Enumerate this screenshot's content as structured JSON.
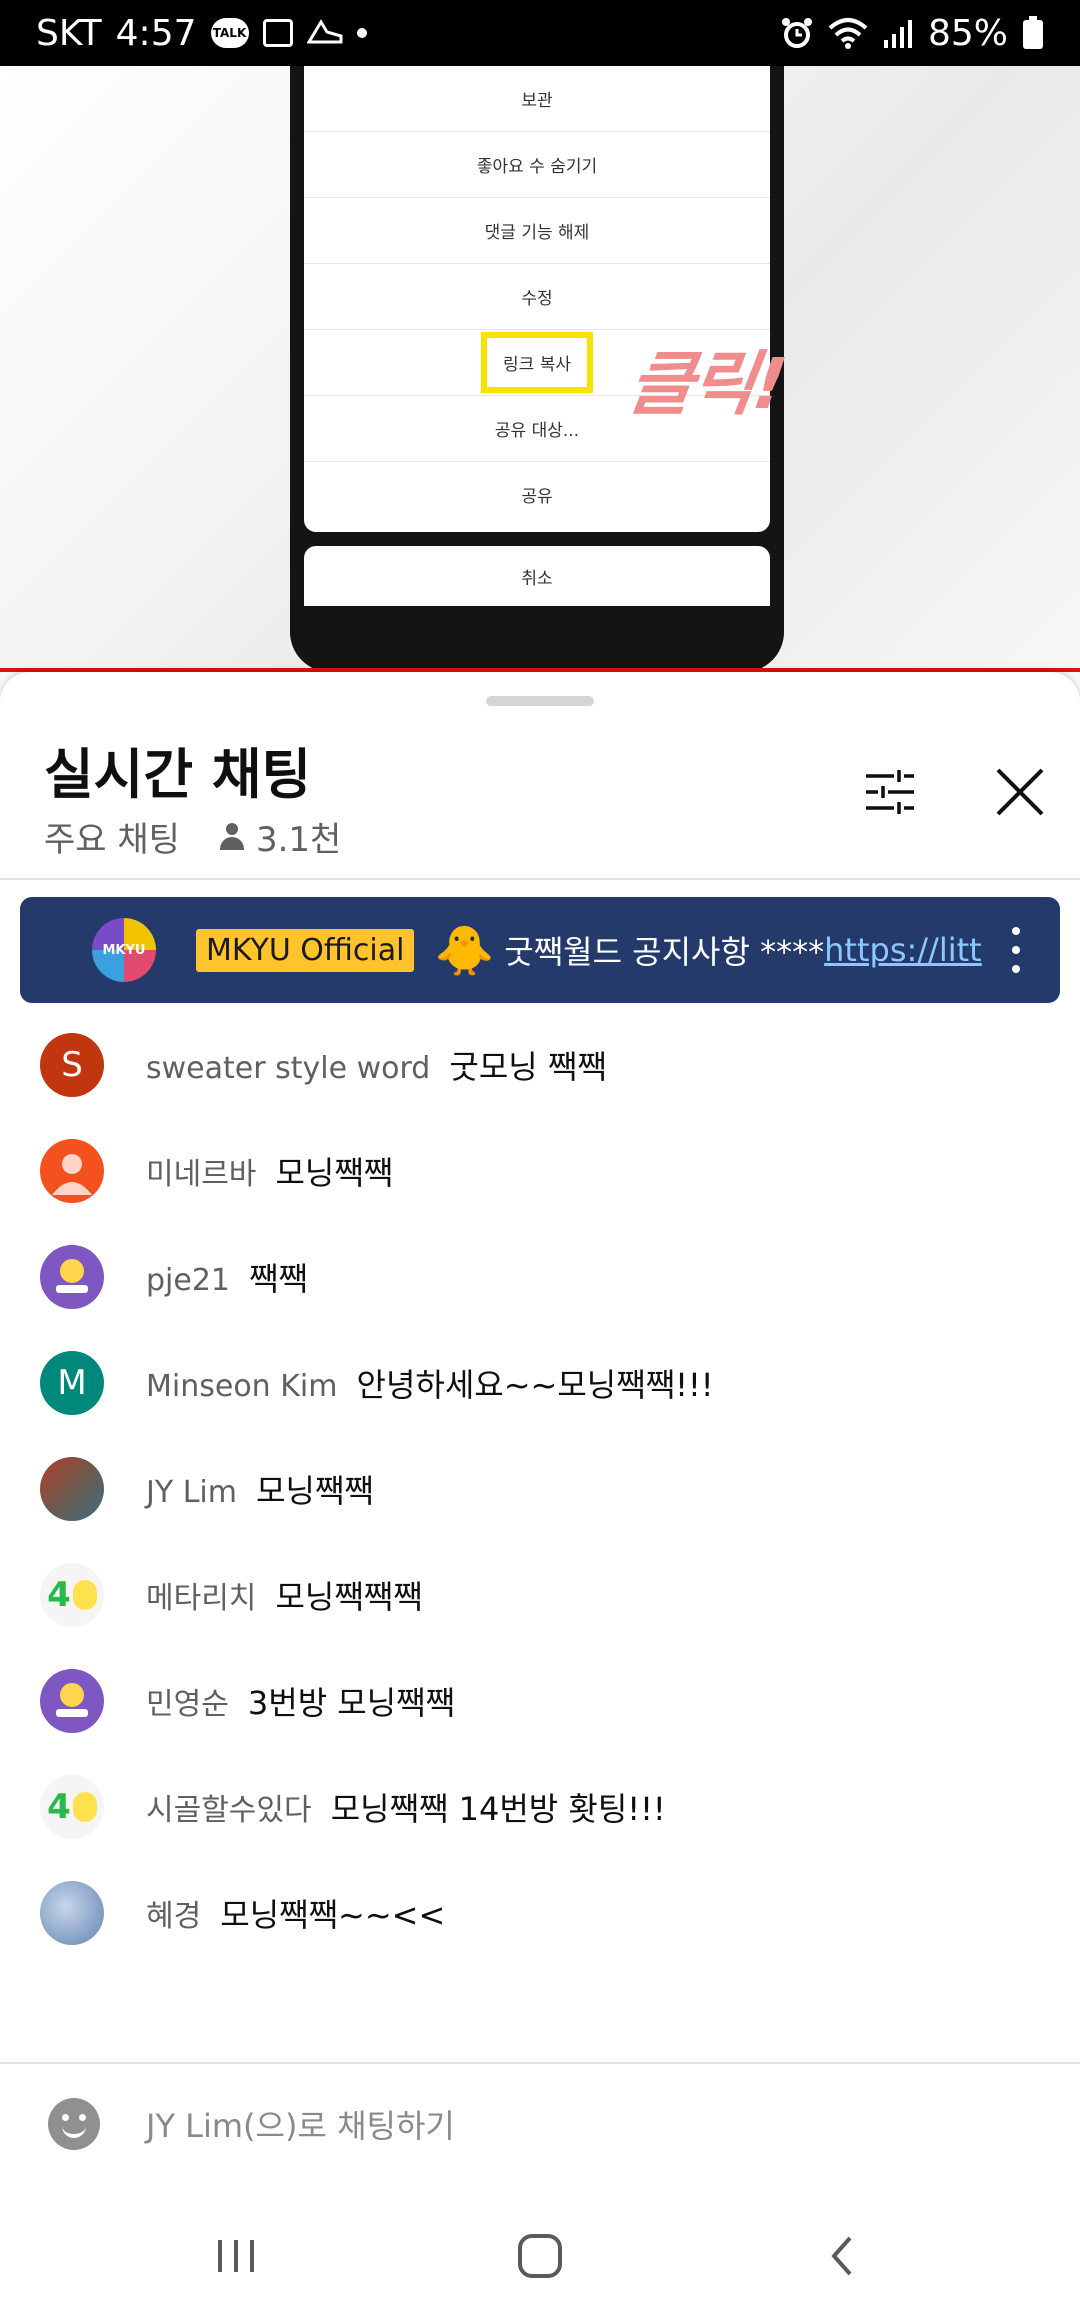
{
  "status_bar": {
    "carrier": "SKT",
    "time": "4:57",
    "talk_icon_text": "TALK",
    "battery": "85%",
    "icons": [
      "kakaotalk-icon",
      "gallery-icon",
      "sneaker-icon",
      "dot-icon",
      "alarm-icon",
      "wifi-icon",
      "signal-icon",
      "battery-icon"
    ]
  },
  "video": {
    "sheet_items": [
      "보관",
      "좋아요 수 숨기기",
      "댓글 기능 해제",
      "수정",
      "링크 복사",
      "공유 대상...",
      "공유"
    ],
    "highlighted_item_index": 4,
    "cancel": "취소",
    "overlay_text": "클릭!",
    "overlay_color": "#f08c8c",
    "highlight_color": "#f5e400"
  },
  "chat_panel": {
    "title": "실시간 채팅",
    "mode": "주요 채팅",
    "viewers": "3.1천",
    "pinned": {
      "avatar_text": "MKYU",
      "author": "MKYU Official",
      "emoji": "🐥",
      "text": "굿짹월드 공지사항 ****",
      "link": "https://litt"
    },
    "messages": [
      {
        "author": "sweater style word",
        "text": "굿모닝 짹짹",
        "avatar": "S",
        "avatar_color": "#c1360f"
      },
      {
        "author": "미네르바",
        "text": "모닝짹짹",
        "avatar": "",
        "avatar_color": "#f4511e"
      },
      {
        "author": "pje21",
        "text": "짹짹",
        "avatar": "",
        "avatar_color": "#7e57c2"
      },
      {
        "author": "Minseon Kim",
        "text": "안녕하세요~~모닝짹짹!!!",
        "avatar": "M",
        "avatar_color": "#00897b"
      },
      {
        "author": "JY Lim",
        "text": "모닝짹짹",
        "avatar": "",
        "avatar_color": "#6d5a4a"
      },
      {
        "author": "메타리치",
        "text": "모닝짹짹짹",
        "avatar": "4",
        "avatar_color": "#f5f5f5"
      },
      {
        "author": "민영순",
        "text": "3번방 모닝짹짹",
        "avatar": "",
        "avatar_color": "#7e57c2"
      },
      {
        "author": "시골할수있다",
        "text": "모닝짹짹 14번방 홧팅!!!",
        "avatar": "4",
        "avatar_color": "#f5f5f5"
      },
      {
        "author": "혜경",
        "text": "모닝짹짹~~<<",
        "avatar": "",
        "avatar_color": "#8aa4c8"
      }
    ],
    "input_placeholder": "JY Lim(으)로 채팅하기"
  }
}
